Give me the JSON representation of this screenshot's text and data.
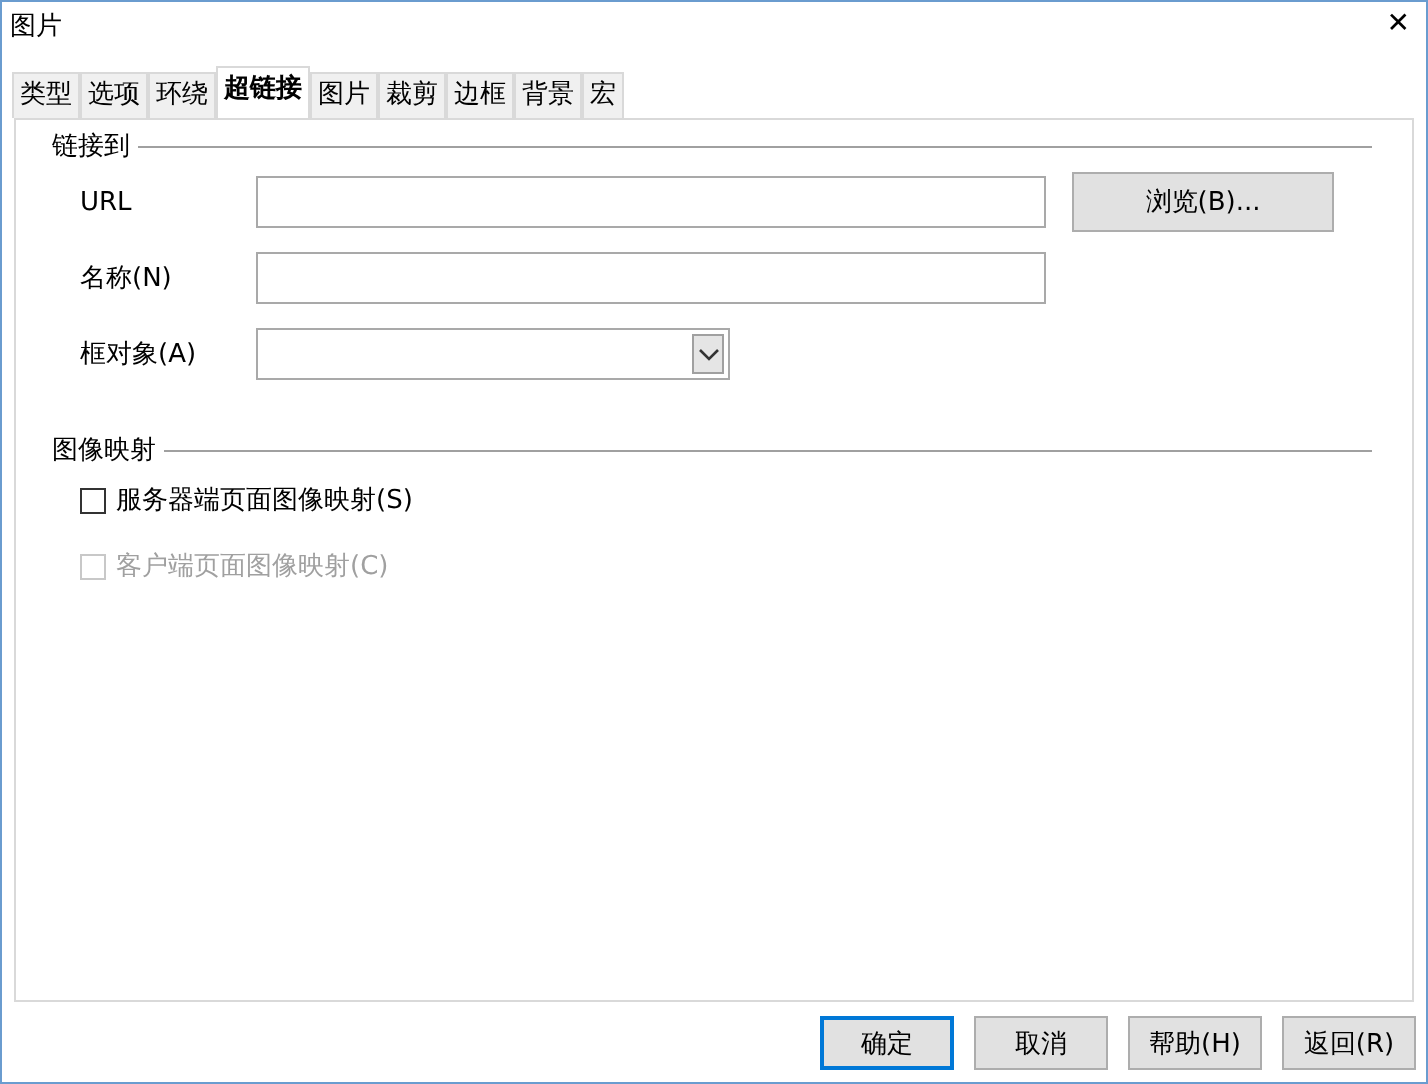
{
  "window": {
    "title": "图片",
    "close": "✕"
  },
  "tabs": [
    {
      "label": "类型",
      "selected": false
    },
    {
      "label": "选项",
      "selected": false
    },
    {
      "label": "环绕",
      "selected": false
    },
    {
      "label": "超链接",
      "selected": true
    },
    {
      "label": "图片",
      "selected": false
    },
    {
      "label": "裁剪",
      "selected": false
    },
    {
      "label": "边框",
      "selected": false
    },
    {
      "label": "背景",
      "selected": false
    },
    {
      "label": "宏",
      "selected": false
    }
  ],
  "link_section": {
    "title": "链接到",
    "fields": [
      {
        "kind": "text",
        "label": "URL",
        "button": "浏览(B)..."
      },
      {
        "kind": "text",
        "label": "名称(N)"
      },
      {
        "kind": "dropdown",
        "label": "框对象(A)"
      }
    ]
  },
  "image_map_section": {
    "title": "图像映射",
    "options": [
      {
        "label": "服务器端页面图像映射(S)",
        "checked": false,
        "disabled": false
      },
      {
        "label": "客户端页面图像映射(C)",
        "checked": false,
        "disabled": true
      }
    ]
  },
  "buttons": [
    {
      "label": "确定",
      "default": true
    },
    {
      "label": "取消",
      "default": false
    },
    {
      "label": "帮助(H)",
      "default": false
    },
    {
      "label": "返回(R)",
      "default": false
    }
  ]
}
